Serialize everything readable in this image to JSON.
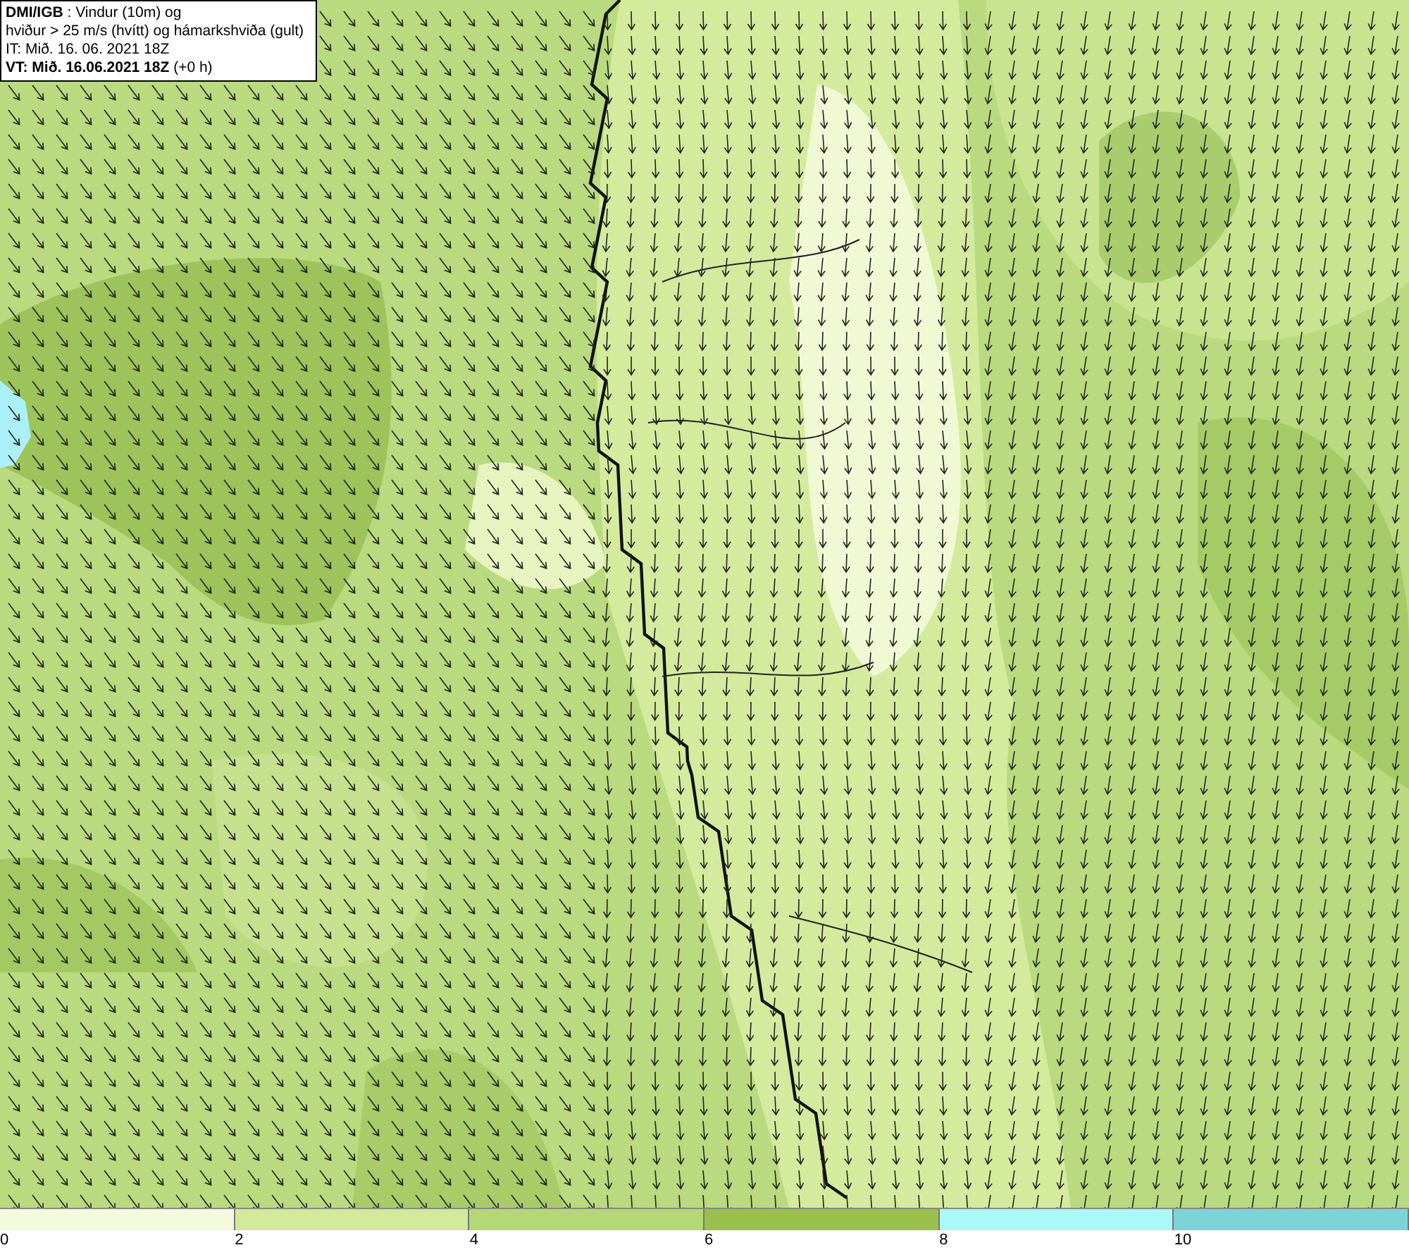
{
  "title_box": {
    "lines": [
      "**DMI/IGB** : Vindur (10m) og",
      "hviður > 25 m/s (hvítt) og hámarkshviða (gult)",
      "IT: Mið. 16. 06. 2021 18Z",
      "**VT: Mið. 16.06.2021 18Z** (+0 h)"
    ]
  },
  "legend": {
    "bins": [
      {
        "color": "#f4fadc"
      },
      {
        "color": "#d2ea9a"
      },
      {
        "color": "#b5d876"
      },
      {
        "color": "#98c04a"
      },
      {
        "color": "#aaf8f8"
      },
      {
        "color": "#7cd4d6"
      }
    ],
    "ticks": [
      "0",
      "2",
      "4",
      "6",
      "8",
      "10"
    ]
  }
}
